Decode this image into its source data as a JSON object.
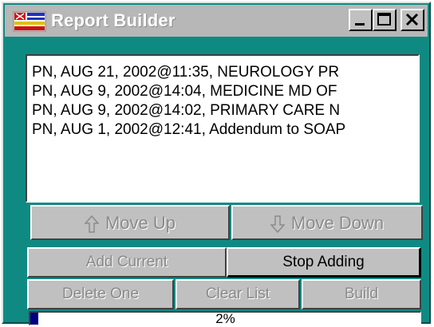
{
  "window": {
    "title": "Report Builder",
    "icon": "report-app-icon",
    "controls": [
      "minimize-icon",
      "maximize-icon",
      "close-icon"
    ]
  },
  "report_list": {
    "items": [
      "PN, AUG 21, 2002@11:35, NEUROLOGY PR",
      "PN, AUG 9, 2002@14:04, MEDICINE MD OF",
      "PN, AUG 9, 2002@14:02, PRIMARY CARE N",
      "PN, AUG 1, 2002@12:41, Addendum to SOAP"
    ]
  },
  "buttons": {
    "move_up": "Move Up",
    "move_up_icon": "arrow-up-icon",
    "move_down": "Move Down",
    "move_down_icon": "arrow-down-icon",
    "add_current": "Add Current",
    "stop_adding": "Stop Adding",
    "delete_one": "Delete One",
    "clear_list": "Clear List",
    "build": "Build"
  },
  "progress": {
    "label": "2%",
    "value_percent": 2
  },
  "colors": {
    "window_frame": "#0f8a83",
    "title_bar": "#b7b7b7",
    "button_face": "#c0c0c0",
    "disabled_text": "#8a8a8a",
    "progress_fill": "#000080"
  }
}
